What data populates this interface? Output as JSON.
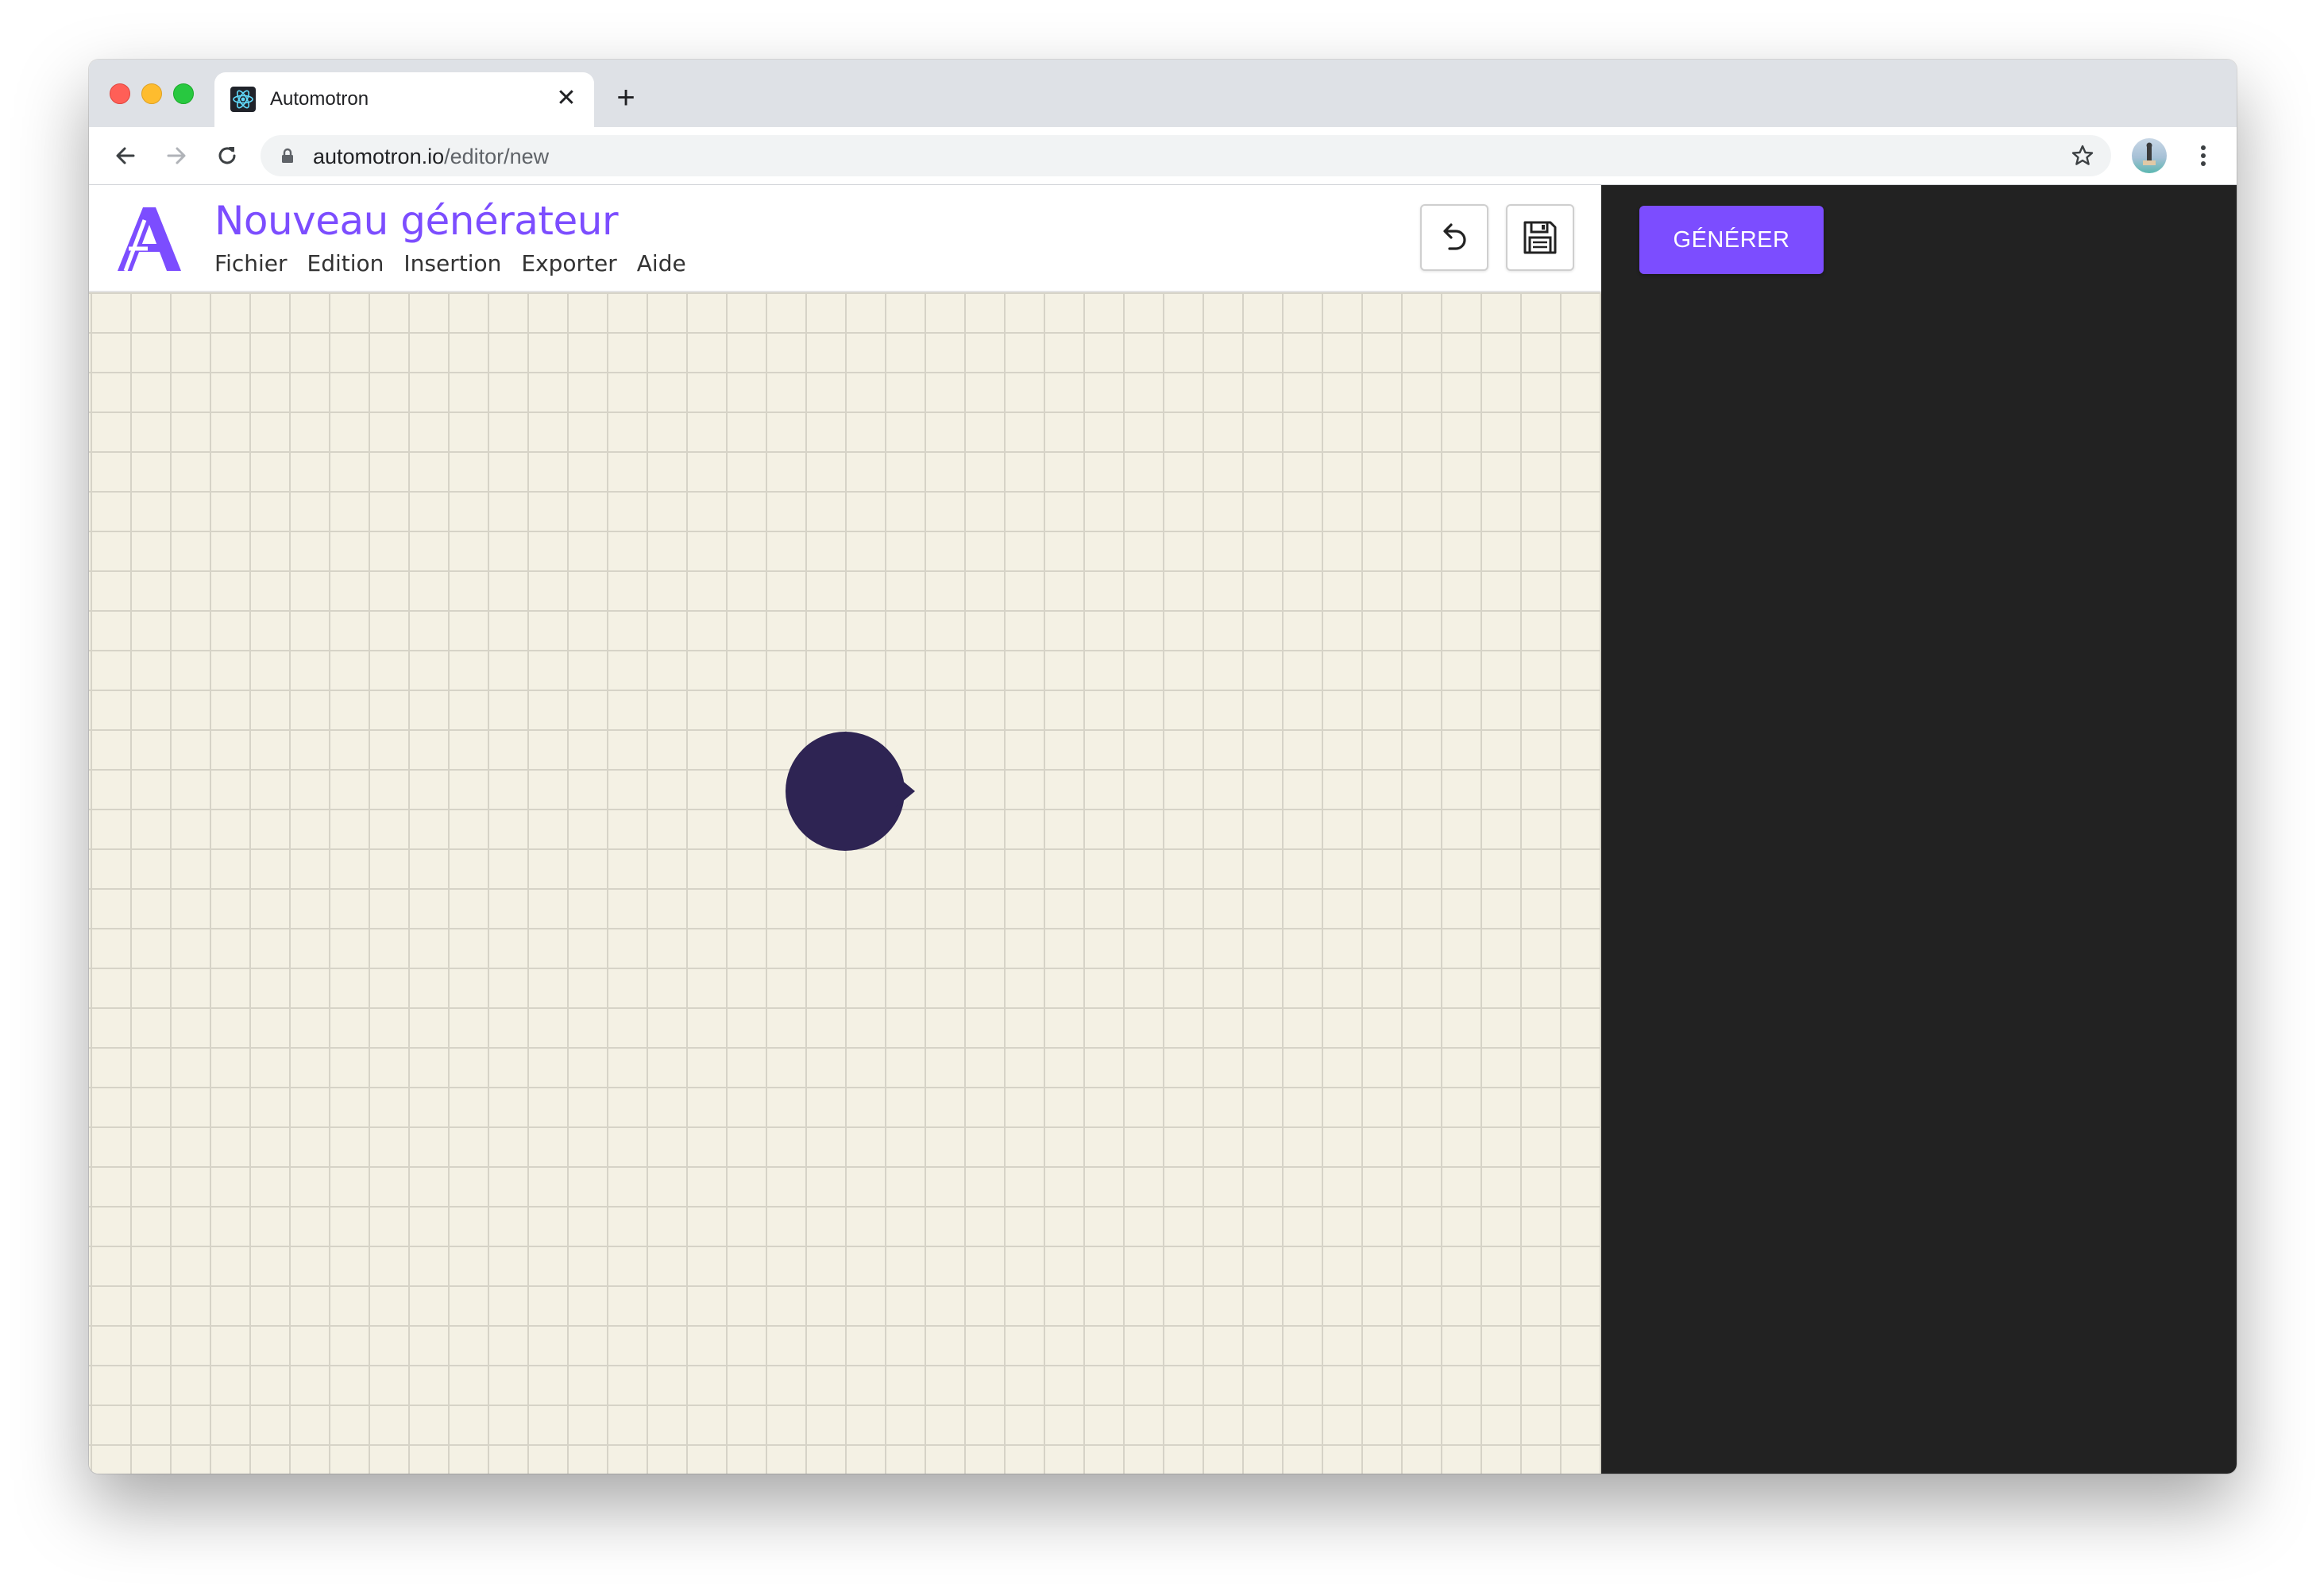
{
  "browser": {
    "tab_title": "Automotron",
    "tab_close": "✕",
    "new_tab": "+",
    "url_host": "automotron.io",
    "url_path": "/editor/new"
  },
  "app": {
    "document_title": "Nouveau générateur",
    "menu": [
      "Fichier",
      "Edition",
      "Insertion",
      "Exporter",
      "Aide"
    ],
    "generate_button": "GÉNÉRER",
    "accent_color": "#7c4dff",
    "panel_color": "#222222",
    "canvas_color": "#f4f1e4",
    "node_color": "#2e2453"
  },
  "icons": {
    "favicon": "react-atom-icon",
    "undo": "undo-icon",
    "save": "floppy-disk-icon"
  }
}
